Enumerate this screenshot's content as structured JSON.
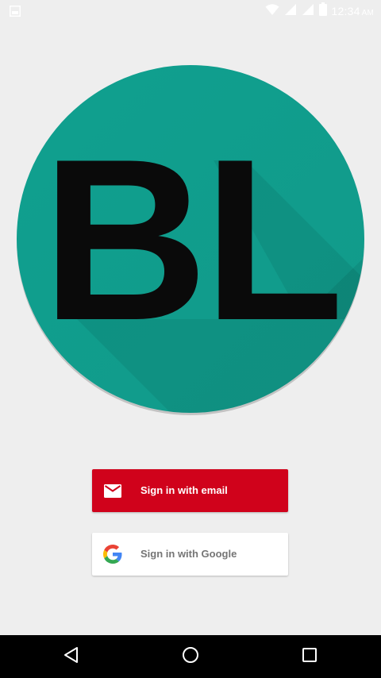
{
  "status_bar": {
    "time": "12:34",
    "ampm": "AM",
    "icons": [
      "image-notification-icon",
      "wifi-icon",
      "signal-icon",
      "signal-icon",
      "battery-icon"
    ]
  },
  "logo": {
    "text": "BL",
    "circle_color": "#119d8c",
    "letter_color": "#0a0a0a"
  },
  "buttons": {
    "email": {
      "label": "Sign in with email",
      "icon": "mail-icon",
      "color": "#d0021b"
    },
    "google": {
      "label": "Sign in with Google",
      "icon": "google-g-icon",
      "color": "#ffffff"
    }
  },
  "nav_bar": {
    "icons": [
      "back-icon",
      "home-icon",
      "recents-icon"
    ]
  }
}
